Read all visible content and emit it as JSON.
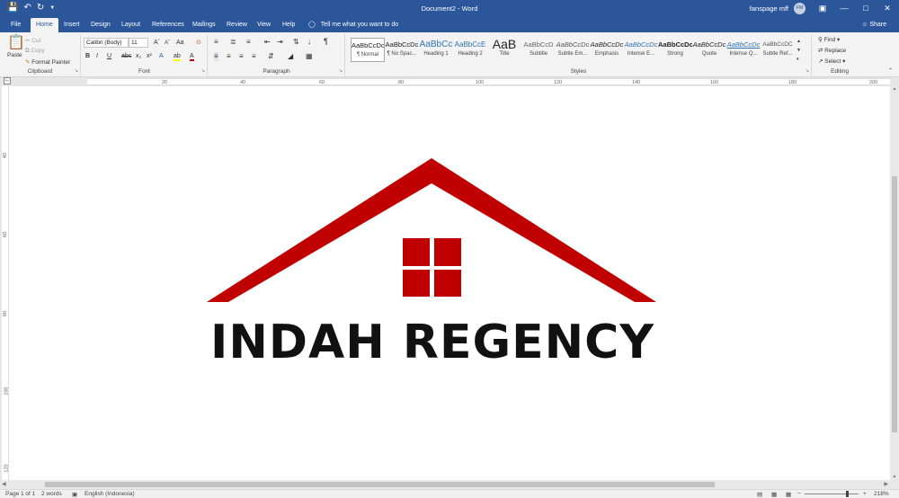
{
  "window": {
    "title": "Document2 - Word",
    "user": "fanspage mff",
    "user_initials": "FM",
    "accent_color": "#2b579a"
  },
  "quick_access": {
    "save_icon": "save-icon",
    "undo_icon": "undo-icon",
    "redo_icon": "redo-icon",
    "customize_icon": "chevron-down-icon"
  },
  "tabs": [
    {
      "label": "File"
    },
    {
      "label": "Home"
    },
    {
      "label": "Insert"
    },
    {
      "label": "Design"
    },
    {
      "label": "Layout"
    },
    {
      "label": "References"
    },
    {
      "label": "Mailings"
    },
    {
      "label": "Review"
    },
    {
      "label": "View"
    },
    {
      "label": "Help"
    }
  ],
  "active_tab": "Home",
  "tell_me": "Tell me what you want to do",
  "share": "Share",
  "ribbon": {
    "clipboard": {
      "label": "Clipboard",
      "paste": "Paste",
      "cut": "Cut",
      "copy": "Copy",
      "format_painter": "Format Painter"
    },
    "font": {
      "label": "Font",
      "font_name": "Calibri (Body)",
      "font_size": "11",
      "bold": "B",
      "italic": "I",
      "underline": "U"
    },
    "paragraph": {
      "label": "Paragraph"
    },
    "styles": {
      "label": "Styles",
      "items": [
        {
          "sample": "AaBbCcDc",
          "name": "¶ Normal"
        },
        {
          "sample": "AaBbCcDc",
          "name": "¶ No Spac..."
        },
        {
          "sample": "AaBbCc",
          "name": "Heading 1"
        },
        {
          "sample": "AaBbCcE",
          "name": "Heading 2"
        },
        {
          "sample": "AaB",
          "name": "Title"
        },
        {
          "sample": "AaBbCcD",
          "name": "Subtitle"
        },
        {
          "sample": "AaBbCcDc",
          "name": "Subtle Em..."
        },
        {
          "sample": "AaBbCcDc",
          "name": "Emphasis"
        },
        {
          "sample": "AaBbCcDc",
          "name": "Intense E..."
        },
        {
          "sample": "AaBbCcDc",
          "name": "Strong"
        },
        {
          "sample": "AaBbCcDc",
          "name": "Quote"
        },
        {
          "sample": "AaBbCcDc",
          "name": "Intense Q..."
        },
        {
          "sample": "AaBbCcDC",
          "name": "Subtle Ref..."
        }
      ]
    },
    "editing": {
      "label": "Editing",
      "find": "Find",
      "replace": "Replace",
      "select": "Select"
    }
  },
  "ruler": {
    "h_labels": [
      "20",
      "40",
      "60",
      "80",
      "100",
      "120",
      "140",
      "160",
      "180",
      "200"
    ],
    "v_labels": [
      "40",
      "60",
      "80",
      "100",
      "120"
    ]
  },
  "document": {
    "company_name": "INDAH REGENCY",
    "logo_color": "#c00000"
  },
  "status": {
    "page": "Page 1 of 1",
    "words": "2 words",
    "language": "English (Indonesia)",
    "zoom": "218%"
  }
}
